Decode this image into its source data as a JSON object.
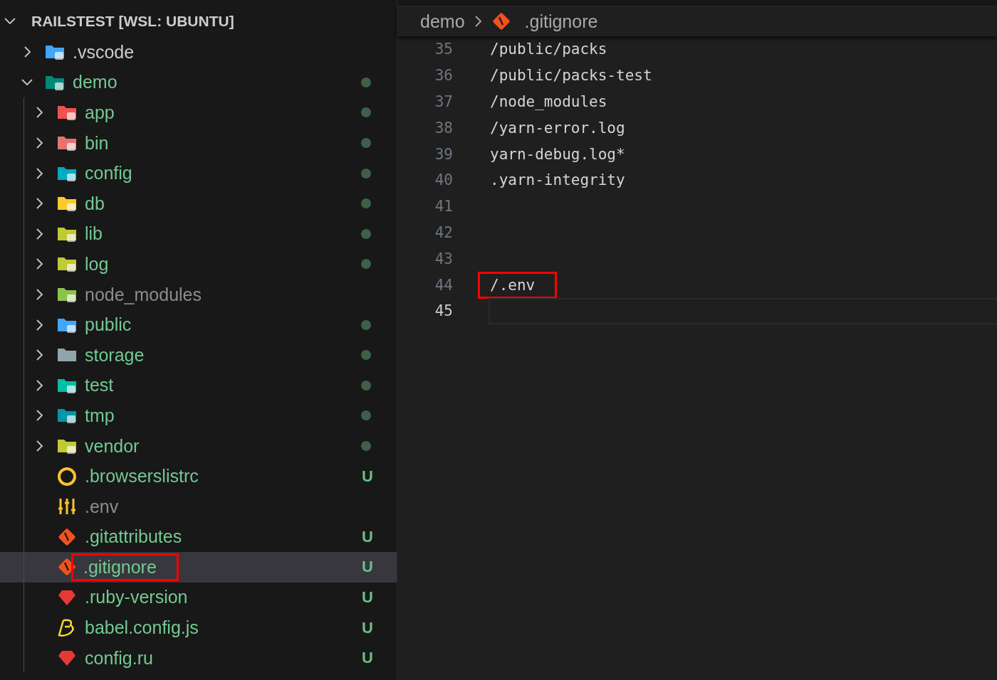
{
  "explorer": {
    "title": "RAILSTEST [WSL: UBUNTU]",
    "expanded": true,
    "items": [
      {
        "name": ".vscode",
        "kind": "vscode",
        "expanded": false,
        "modified": false,
        "ignored": false,
        "selected": false
      },
      {
        "name": "demo",
        "kind": "demo",
        "expanded": true,
        "modified": true,
        "ignored": false,
        "selected": false,
        "children": [
          {
            "name": "app",
            "kind": "app",
            "expanded": false,
            "modified": true,
            "ignored": false,
            "selected": false
          },
          {
            "name": "bin",
            "kind": "bin",
            "expanded": false,
            "modified": true,
            "ignored": false,
            "selected": false
          },
          {
            "name": "config",
            "kind": "config",
            "expanded": false,
            "modified": true,
            "ignored": false,
            "selected": false
          },
          {
            "name": "db",
            "kind": "db",
            "expanded": false,
            "modified": true,
            "ignored": false,
            "selected": false
          },
          {
            "name": "lib",
            "kind": "lib",
            "expanded": false,
            "modified": true,
            "ignored": false,
            "selected": false
          },
          {
            "name": "log",
            "kind": "log",
            "expanded": false,
            "modified": true,
            "ignored": false,
            "selected": false
          },
          {
            "name": "node_modules",
            "kind": "node",
            "expanded": false,
            "modified": false,
            "ignored": true,
            "selected": false
          },
          {
            "name": "public",
            "kind": "public",
            "expanded": false,
            "modified": true,
            "ignored": false,
            "selected": false
          },
          {
            "name": "storage",
            "kind": "storage",
            "expanded": false,
            "modified": true,
            "ignored": false,
            "selected": false
          },
          {
            "name": "test",
            "kind": "test",
            "expanded": false,
            "modified": true,
            "ignored": false,
            "selected": false
          },
          {
            "name": "tmp",
            "kind": "tmp",
            "expanded": false,
            "modified": true,
            "ignored": false,
            "selected": false
          },
          {
            "name": "vendor",
            "kind": "vendor",
            "expanded": false,
            "modified": true,
            "ignored": false,
            "selected": false
          },
          {
            "name": ".browserslistrc",
            "kind": "browserslist",
            "modified": false,
            "ignored": false,
            "badge": "U",
            "selected": false
          },
          {
            "name": ".env",
            "kind": "env",
            "modified": false,
            "ignored": true,
            "selected": false
          },
          {
            "name": ".gitattributes",
            "kind": "git",
            "modified": false,
            "ignored": false,
            "badge": "U",
            "selected": false
          },
          {
            "name": ".gitignore",
            "kind": "git",
            "modified": false,
            "ignored": false,
            "badge": "U",
            "selected": true,
            "highlighted": true
          },
          {
            "name": ".ruby-version",
            "kind": "ruby",
            "modified": false,
            "ignored": false,
            "badge": "U",
            "selected": false
          },
          {
            "name": "babel.config.js",
            "kind": "babel",
            "modified": false,
            "ignored": false,
            "badge": "U",
            "selected": false
          },
          {
            "name": "config.ru",
            "kind": "ruby",
            "modified": false,
            "ignored": false,
            "badge": "U",
            "selected": false
          }
        ]
      }
    ]
  },
  "editor": {
    "breadcrumbs": [
      {
        "label": "demo",
        "kind": "folder"
      },
      {
        "label": ".gitignore",
        "kind": "git"
      }
    ],
    "lines": [
      {
        "number": "35",
        "text": "/public/packs",
        "current": false
      },
      {
        "number": "36",
        "text": "/public/packs-test",
        "current": false
      },
      {
        "number": "37",
        "text": "/node_modules",
        "current": false
      },
      {
        "number": "38",
        "text": "/yarn-error.log",
        "current": false
      },
      {
        "number": "39",
        "text": "yarn-debug.log*",
        "current": false
      },
      {
        "number": "40",
        "text": ".yarn-integrity",
        "current": false
      },
      {
        "number": "41",
        "current": false
      },
      {
        "number": "42",
        "current": false
      },
      {
        "number": "43",
        "current": false
      },
      {
        "number": "44",
        "text": "/.env",
        "current": false,
        "highlighted": true
      },
      {
        "number": "45",
        "current": true
      }
    ]
  }
}
